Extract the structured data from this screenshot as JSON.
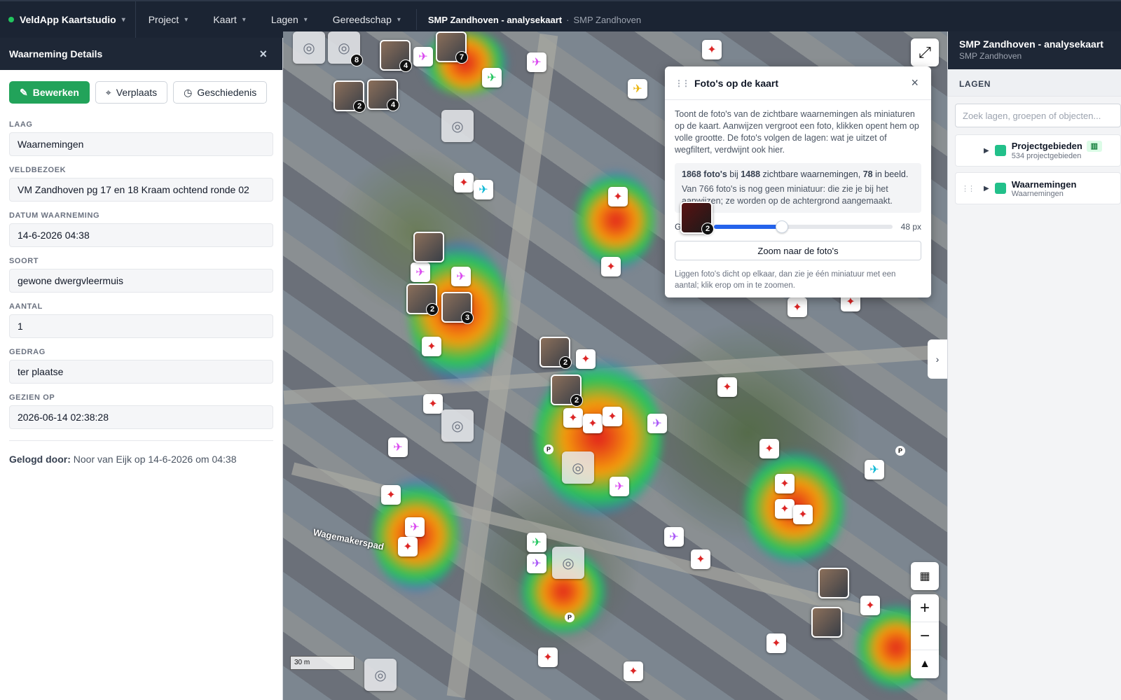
{
  "topbar": {
    "app_name": "VeldApp Kaartstudio",
    "menus": [
      "Project",
      "Kaart",
      "Lagen",
      "Gereedschap"
    ],
    "map_title": "SMP Zandhoven - analysekaart",
    "separator": "·",
    "map_subtitle": "SMP Zandhoven"
  },
  "details": {
    "title": "Waarneming Details",
    "close": "×",
    "actions": {
      "edit": "Bewerken",
      "move": "Verplaats",
      "history": "Geschiedenis"
    },
    "fields": [
      {
        "label": "LAAG",
        "value": "Waarnemingen"
      },
      {
        "label": "VELDBEZOEK",
        "value": "VM Zandhoven pg 17 en 18 Kraam ochtend ronde 02"
      },
      {
        "label": "DATUM WAARNEMING",
        "value": "14-6-2026 04:38"
      },
      {
        "label": "SOORT",
        "value": "gewone dwergvleermuis"
      },
      {
        "label": "AANTAL",
        "value": "1"
      },
      {
        "label": "GEDRAG",
        "value": "ter plaatse"
      },
      {
        "label": "GEZIEN OP",
        "value": "2026-06-14 02:38:28"
      }
    ],
    "logged_label": "Gelogd door:",
    "logged_value": "Noor van Eijk op 14-6-2026 om 04:38"
  },
  "map": {
    "road_label": "Wagemakerspad",
    "scale": "30 m",
    "thumb_counts": [
      "8",
      "4",
      "7",
      "2",
      "4",
      "2",
      "3",
      "2",
      "2"
    ],
    "parking": "P",
    "zoom_in": "+",
    "zoom_out": "−",
    "north": "▲"
  },
  "photo_popup": {
    "title": "Foto's op de kaart",
    "close": "×",
    "description": "Toont de foto's van de zichtbare waarnemingen als miniaturen op de kaart. Aanwijzen vergroot een foto, klikken opent hem op volle grootte. De foto's volgen de lagen: wat je uitzet of wegfiltert, verdwijnt ook hier.",
    "stats": {
      "photos": "1868 foto's",
      "mid1": " bij ",
      "observations": "1488",
      "mid2": " zichtbare waarnemingen, ",
      "in_view": "78",
      "end": " in beeld."
    },
    "pending_note": "Van 766 foto's is nog geen miniatuur: die zie je bij het aanwijzen; ze worden op de achtergrond aangemaakt.",
    "slider_label": "G",
    "slider_value": "48 px",
    "slider_fraction": 0.38,
    "preview_count": "2",
    "zoom_button": "Zoom naar de foto's",
    "footer": "Liggen foto's dicht op elkaar, dan zie je één miniatuur met een aantal; klik erop om in te zoomen."
  },
  "layers_panel": {
    "title": "SMP Zandhoven - analysekaart",
    "subtitle": "SMP Zandhoven",
    "section": "LAGEN",
    "search_placeholder": "Zoek lagen, groepen of objecten...",
    "layers": [
      {
        "name": "Projectgebieden",
        "sub": "534 projectgebieden",
        "color": "#22c08a"
      },
      {
        "name": "Waarnemingen",
        "sub": "Waarnemingen",
        "color": "#22c08a"
      }
    ]
  },
  "colors": {
    "accent": "#22a35a",
    "slider": "#2563eb",
    "dark": "#1b2433"
  }
}
